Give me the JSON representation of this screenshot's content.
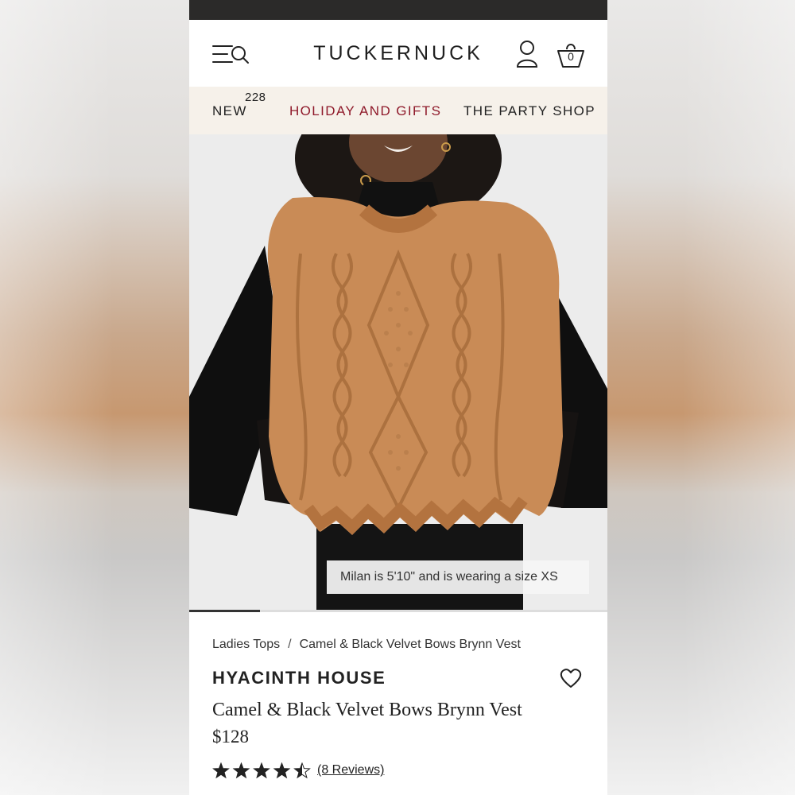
{
  "header": {
    "logo": "TUCKERNUCK",
    "bag_count": "0"
  },
  "nav": {
    "items": [
      {
        "label": "NEW",
        "badge": "228"
      },
      {
        "label": "HOLIDAY AND GIFTS"
      },
      {
        "label": "THE PARTY SHOP"
      }
    ],
    "highlight_color": "#8f1a2b"
  },
  "image": {
    "caption": "Milan is 5'10\" and is wearing a size XS",
    "progress": 0.17
  },
  "breadcrumb": {
    "parent": "Ladies Tops",
    "separator": "/",
    "current": "Camel & Black Velvet Bows Brynn Vest"
  },
  "product": {
    "brand": "HYACINTH HOUSE",
    "title": "Camel & Black Velvet Bows Brynn Vest",
    "price": "$128",
    "rating": 4.5,
    "reviews_label": "(8 Reviews)"
  },
  "colors": {
    "accent": "#8f1a2b",
    "nav_background": "#f6f1ea",
    "vest": "#c98b56"
  }
}
